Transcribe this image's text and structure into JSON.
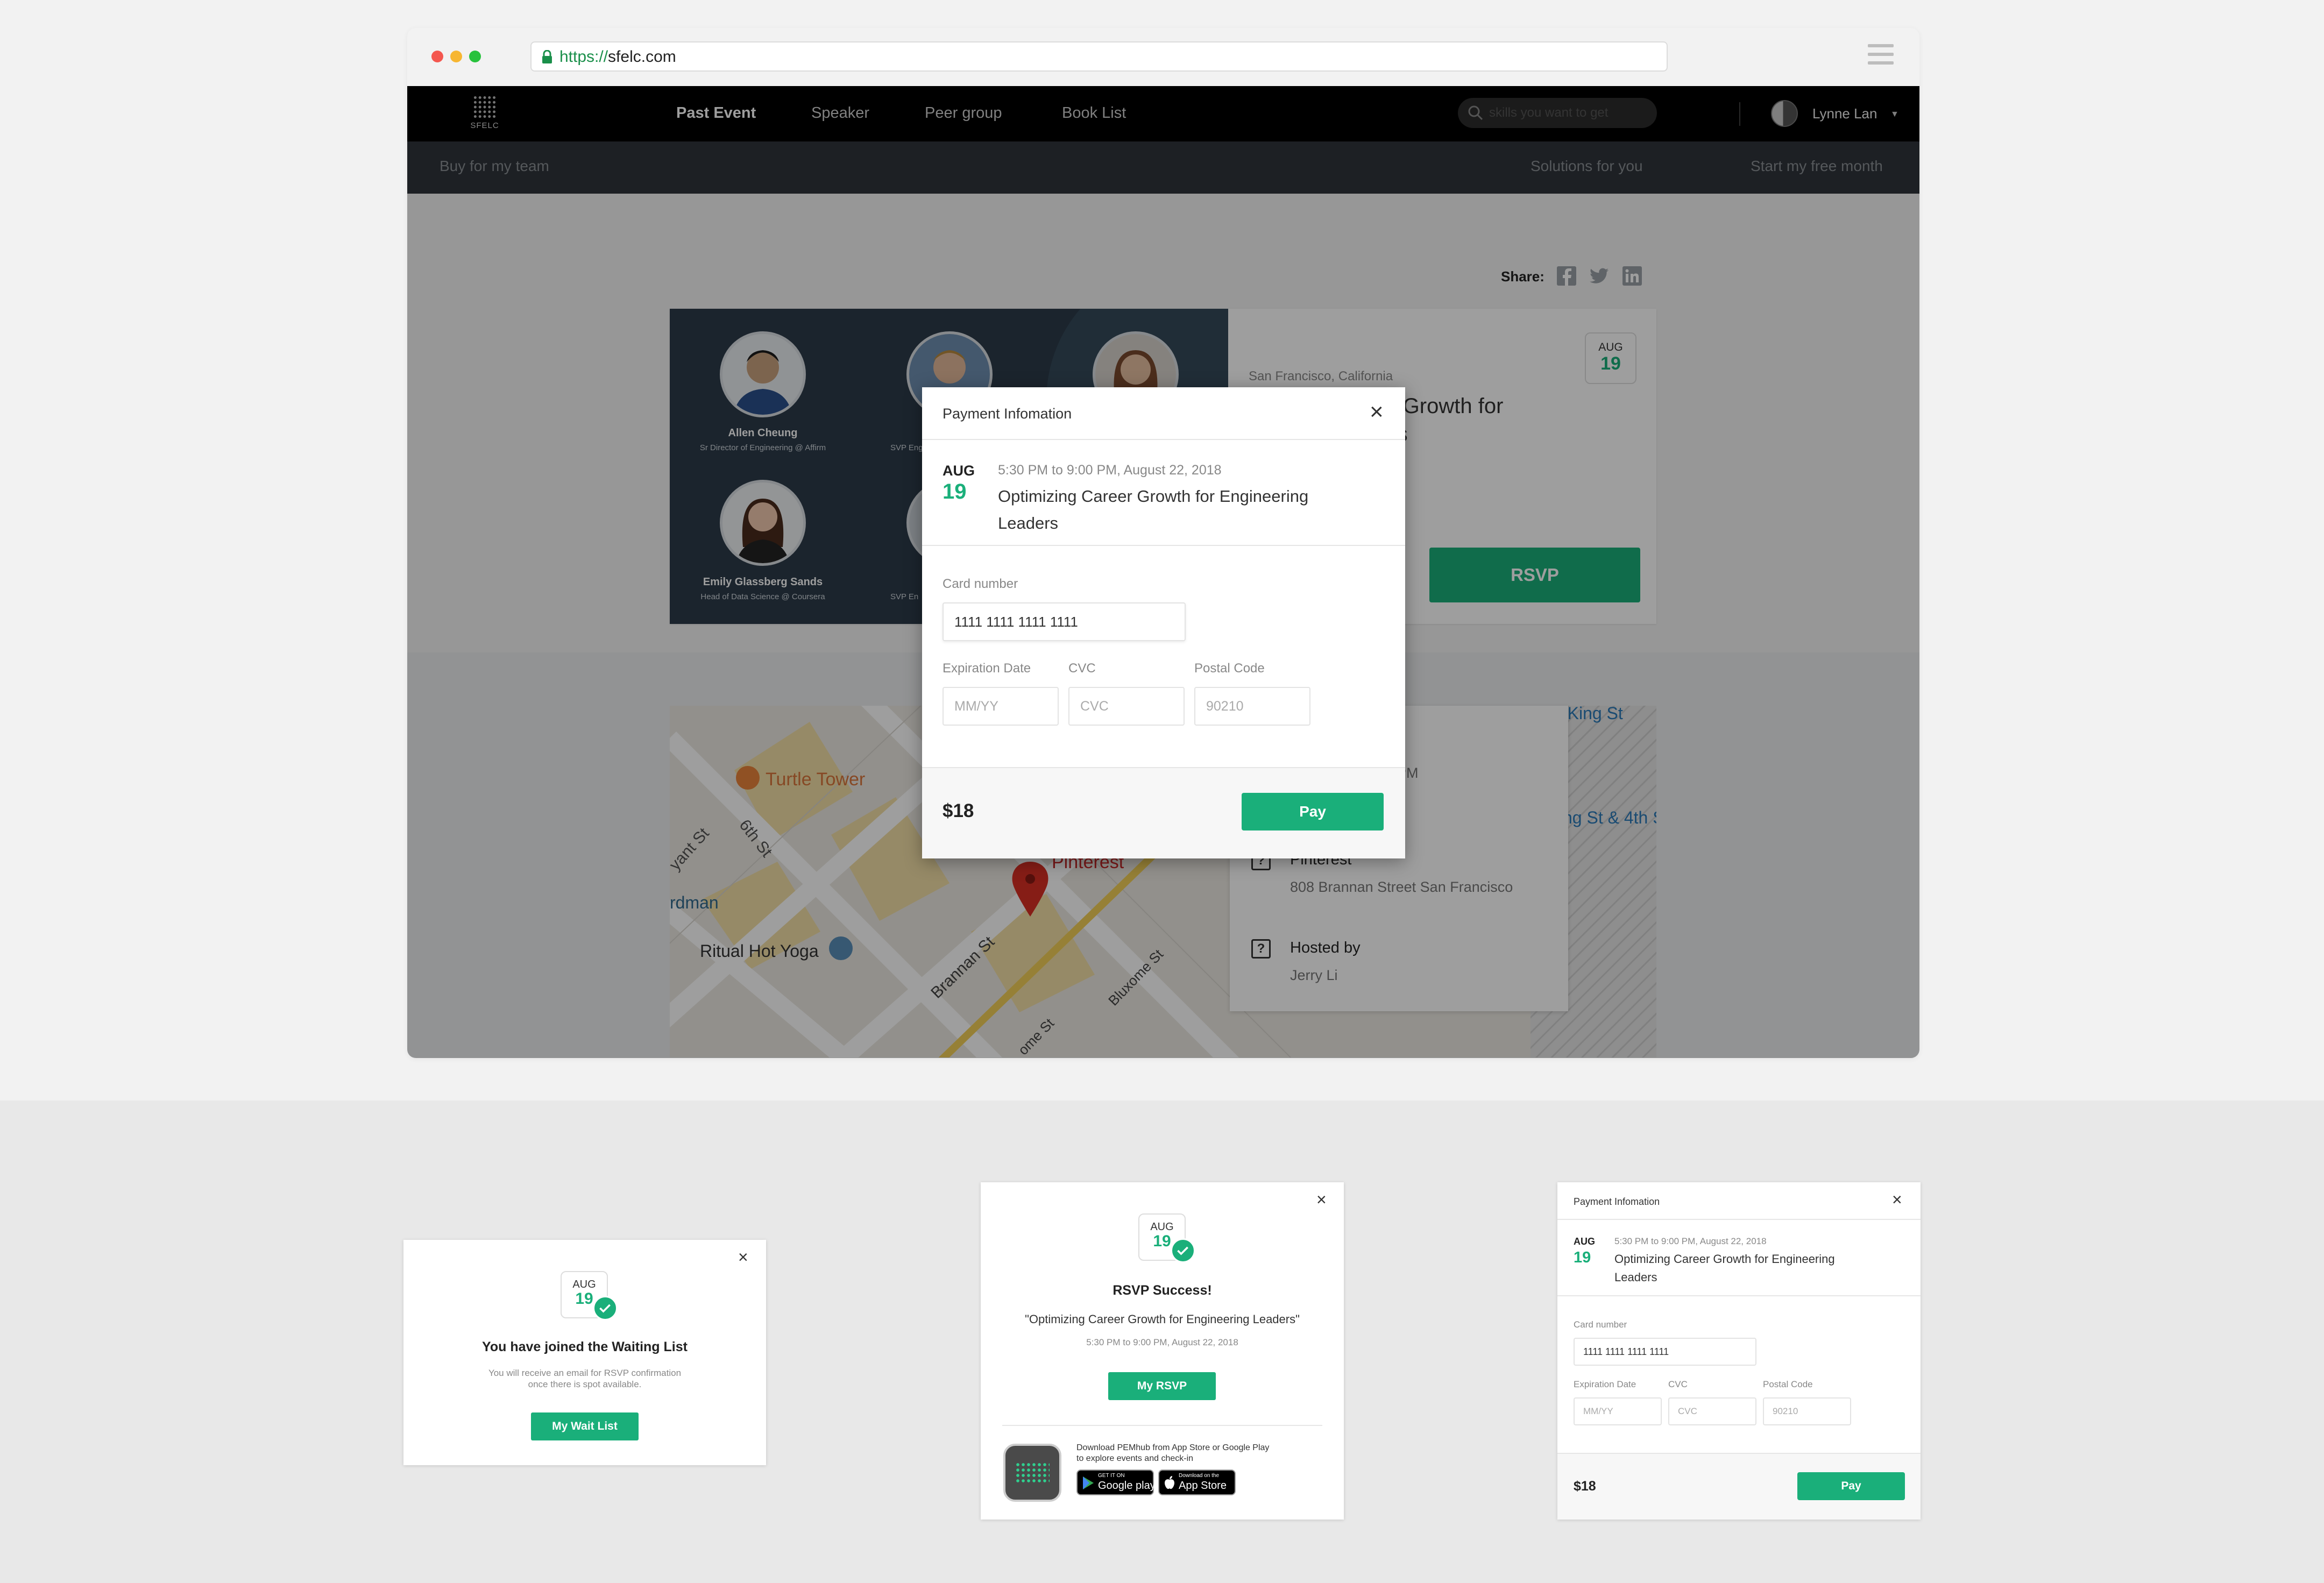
{
  "browser": {
    "url_scheme": "https://",
    "url_host": "sfelc.com"
  },
  "nav": {
    "logo_text": "SFELC",
    "links": [
      "Past Event",
      "Speaker",
      "Peer group",
      "Book List"
    ],
    "search_placeholder": "skills you want to get",
    "user_name": "Lynne Lan"
  },
  "subnav": {
    "left": "Buy for my team",
    "right": [
      "Solutions for you",
      "Start my free month"
    ]
  },
  "share": {
    "label": "Share:"
  },
  "speakers": [
    {
      "name": "Allen Cheung",
      "title": "Sr Director of Engineering @ Affirm"
    },
    {
      "name": "",
      "title": "SVP Eng"
    },
    {
      "name": "",
      "title": ""
    },
    {
      "name": "Emily Glassberg Sands",
      "title": "Head of Data Science @ Coursera"
    },
    {
      "name": "",
      "title": "SVP En"
    }
  ],
  "event": {
    "location": "San Francisco, California",
    "title_partial": "er Growth for",
    "title_partial2": "ers",
    "date_month": "AUG",
    "date_day": "19",
    "rsvp_label": "RSVP",
    "left_partial": "ft"
  },
  "map": {
    "labels": [
      "Turtle Tower",
      "6th St",
      "yant St",
      "rdman",
      "Ritual Hot Yoga",
      "Pinterest",
      "Brannan St",
      "Bluxome St",
      "ome St",
      "4th & King St",
      "ng St & 4th S"
    ]
  },
  "info": {
    "time_partial": "PM",
    "place_name": "Pinterest",
    "place_address": "808 Brannan Street San Francisco",
    "hosted_label": "Hosted by",
    "host_name": "Jerry Li",
    "icon_glyph": "?"
  },
  "payment": {
    "title": "Payment Infomation",
    "month": "AUG",
    "day": "19",
    "time": "5:30 PM to 9:00 PM, August 22, 2018",
    "event_title": "Optimizing Career Growth for Engineering Leaders",
    "card_label": "Card number",
    "card_value": "1111 1111 1111 1111",
    "exp_label": "Expiration Date",
    "exp_placeholder": "MM/YY",
    "cvc_label": "CVC",
    "cvc_placeholder": "CVC",
    "postal_label": "Postal Code",
    "postal_placeholder": "90210",
    "price": "$18",
    "pay_label": "Pay"
  },
  "waitlist": {
    "month": "AUG",
    "day": "19",
    "heading": "You have joined the Waiting List",
    "text1": "You will receive an email for RSVP confirmation",
    "text2": "once there is spot available.",
    "button": "My Wait List"
  },
  "rsvp_success": {
    "month": "AUG",
    "day": "19",
    "heading": "RSVP Success!",
    "event_quote": "\"Optimizing Career Growth for Engineering Leaders\"",
    "time": "5:30 PM to 9:00 PM, August 22, 2018",
    "button": "My RSVP",
    "download1": "Download PEMhub from App Store or Google Play",
    "download2": "to explore events and check-in",
    "google_small": "GET IT ON",
    "google_big": "Google play",
    "apple_small": "Download on the",
    "apple_big": "App Store"
  },
  "colors": {
    "accent": "#1aaf7a",
    "nav_bg": "#000000",
    "subnav_bg": "#2f353b"
  }
}
